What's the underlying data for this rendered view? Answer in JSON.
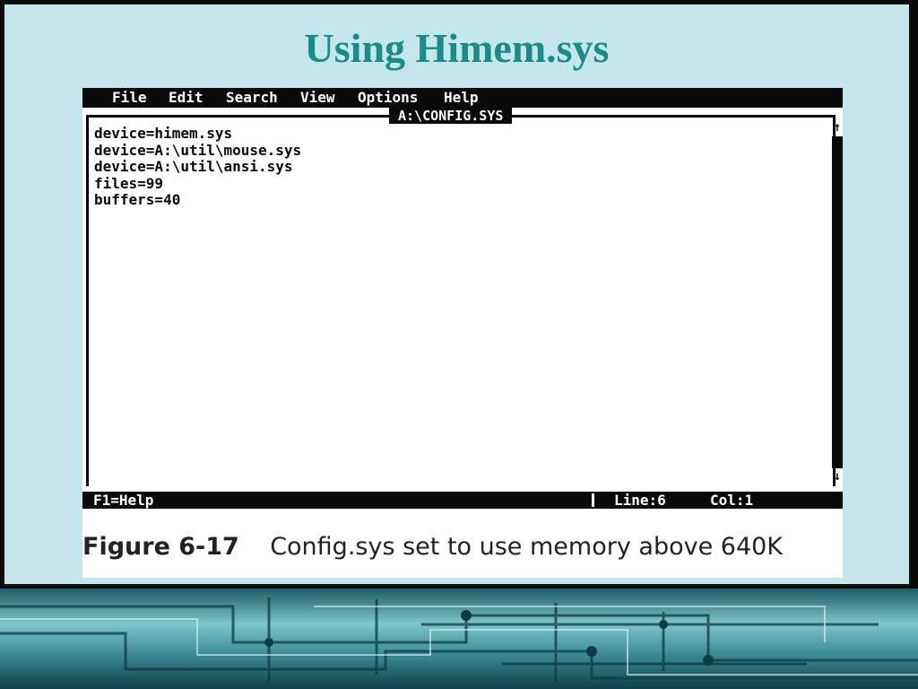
{
  "slide": {
    "title": "Using Himem.sys"
  },
  "editor": {
    "menu": [
      "File",
      "Edit",
      "Search",
      "View",
      "Options",
      "Help"
    ],
    "file_title": "A:\\CONFIG.SYS",
    "lines": [
      "device=himem.sys",
      "device=A:\\util\\mouse.sys",
      "device=A:\\util\\ansi.sys",
      "files=99",
      "buffers=40"
    ],
    "scroll_up": "↑",
    "scroll_down": "↓",
    "status": {
      "help": "F1=Help",
      "line": "Line:6",
      "col": "Col:1"
    }
  },
  "caption": {
    "label": "Figure 6-17",
    "text": "Config.sys set to use memory above 640K"
  },
  "colors": {
    "title": "#1a8a8a",
    "slide_bg": "#c5e6ea",
    "terminal": "#0a0a0a"
  }
}
